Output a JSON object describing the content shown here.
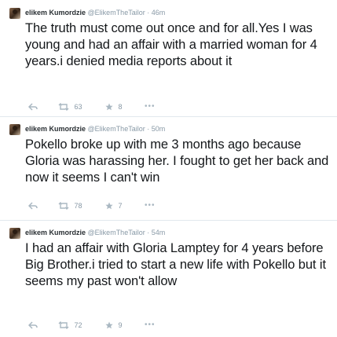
{
  "tweets": [
    {
      "name": "elikem Kumordzie",
      "handle": "@ElikemTheTailor",
      "separator": "·",
      "time": "46m",
      "text": "The truth must come out once and for all.Yes I was young and had an affair with a married woman for 4 years.i denied media reports about it",
      "retweets": "63",
      "favorites": "8",
      "more": "•••"
    },
    {
      "name": "elikem Kumordzie",
      "handle": "@ElikemTheTailor",
      "separator": "·",
      "time": "50m",
      "text": "Pokello broke up with me 3 months ago because Gloria was harassing her. I fought to get her back and now it seems  I can't win",
      "retweets": "78",
      "favorites": "7",
      "more": "•••"
    },
    {
      "name": "elikem Kumordzie",
      "handle": "@ElikemTheTailor",
      "separator": "·",
      "time": "54m",
      "text": "I had an affair with Gloria Lamptey for 4 years before Big Brother.i tried to start a new life with Pokello but it seems my past won't allow",
      "retweets": "72",
      "favorites": "9",
      "more": "•••"
    }
  ],
  "colors": {
    "name": "#292f33",
    "meta": "#8899a6",
    "body": "#14171a",
    "separator": "#e1e8ed"
  },
  "icons": [
    "reply-icon",
    "retweet-icon",
    "favorite-icon",
    "more-icon"
  ]
}
